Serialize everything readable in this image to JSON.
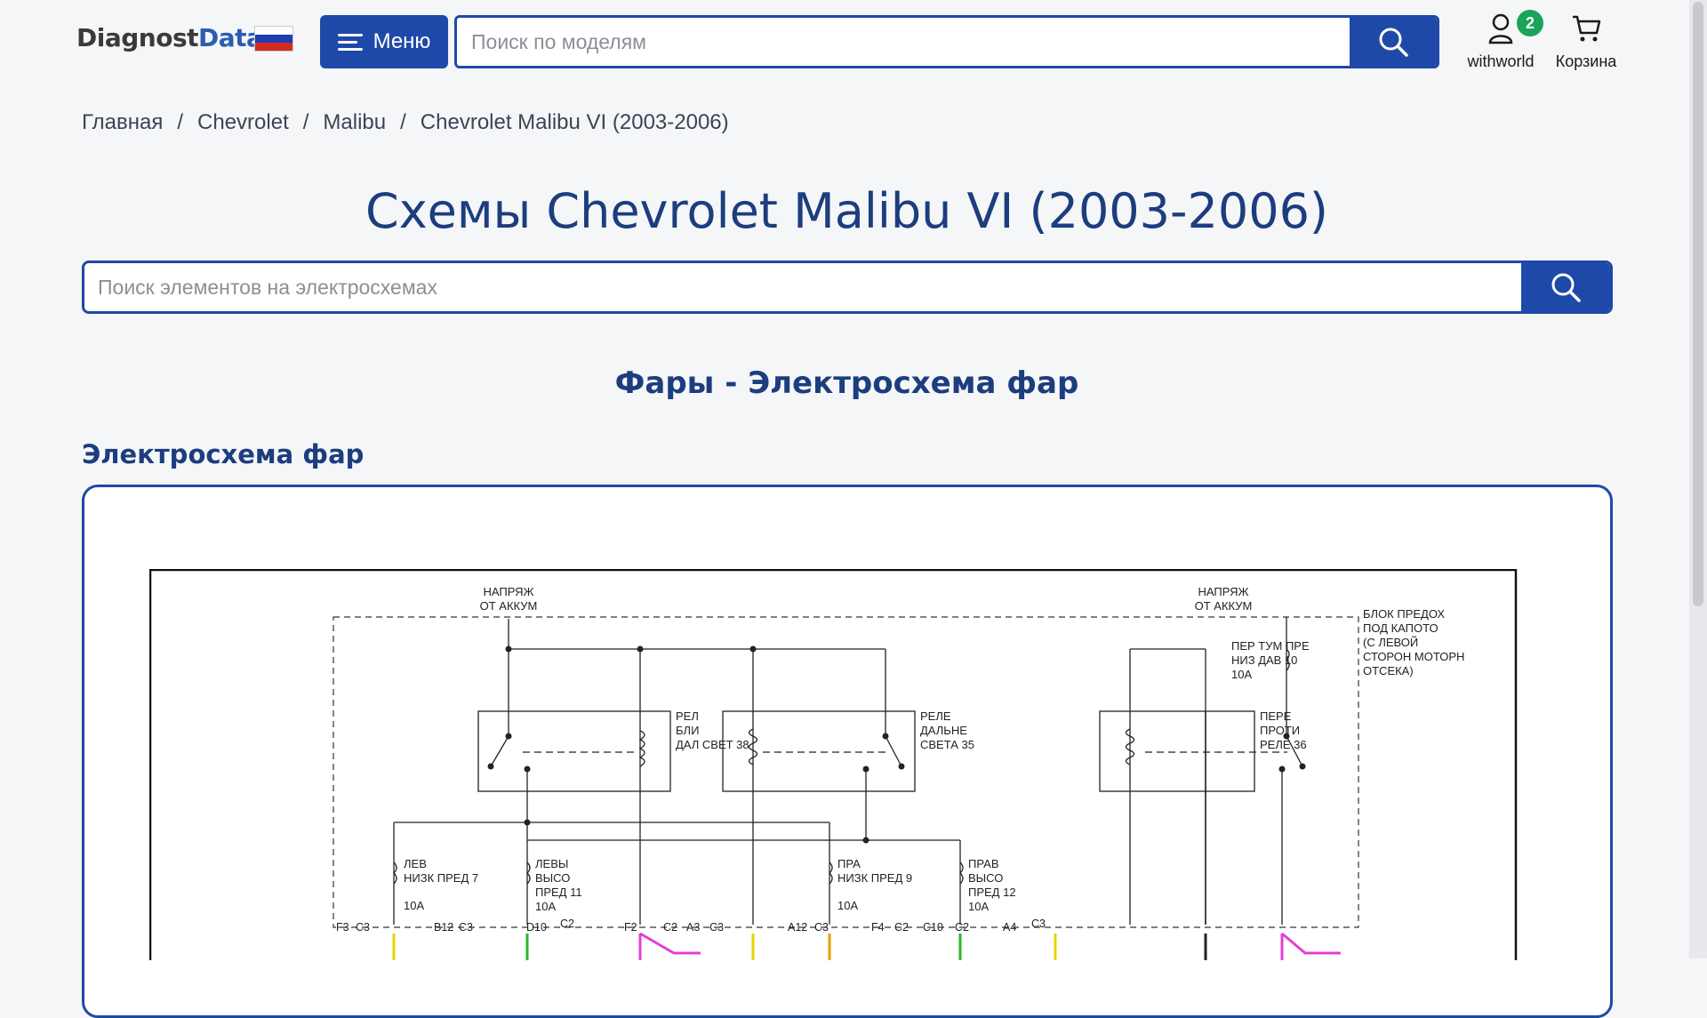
{
  "header": {
    "logo_part1": "Diagnost",
    "logo_part2": "Data",
    "menu_label": "Меню",
    "search_placeholder": "Поиск по моделям",
    "user_label": "withworld",
    "user_badge": "2",
    "cart_label": "Корзина"
  },
  "breadcrumb": {
    "items": [
      "Главная",
      "Chevrolet",
      "Malibu",
      "Chevrolet Malibu VI (2003-2006)"
    ],
    "separator": "/"
  },
  "page_title": "Схемы Chevrolet Malibu VI (2003-2006)",
  "element_search": {
    "placeholder": "Поиск элементов на электросхемах"
  },
  "section_title": "Фары - Электросхема фар",
  "sub_title": "Электросхема фар",
  "diagram": {
    "labels": {
      "bat1": [
        "НАПРЯЖ",
        "ОТ АККУМ"
      ],
      "bat2": [
        "НАПРЯЖ",
        "ОТ АККУМ"
      ],
      "block": [
        "БЛОК ПРЕДОХ",
        "ПОД КАПОТО",
        "(С ЛЕВОЙ",
        "СТОРОН МОТОРН",
        "ОТСЕКА)"
      ],
      "relay_low": [
        "РЕЛ",
        "БЛИ",
        "ДАЛ СВЕТ 38"
      ],
      "relay_high": [
        "РЕЛЕ",
        "ДАЛЬНЕ",
        "СВЕТА 35"
      ],
      "relay_fog": [
        "ПЕРЕ",
        "ПРОТИ",
        "РЕЛЕ 36"
      ],
      "fuse_fog": [
        "ПЕР ТУМ ПРЕ",
        "НИЗ ДАВ 10",
        "10A"
      ],
      "fuse7": [
        "ЛЕВ",
        "НИЗК ПРЕД 7",
        "10A"
      ],
      "fuse11": [
        "ЛЕВЫ",
        "ВЫСО",
        "ПРЕД 11",
        "10A"
      ],
      "fuse9": [
        "ПРА",
        "НИЗК ПРЕД 9",
        "10A"
      ],
      "fuse12": [
        "ПРАВ",
        "ВЫСО",
        "ПРЕД 12",
        "10A"
      ]
    },
    "connectors": [
      "F3",
      "C3",
      "B12",
      "C3",
      "D10",
      "C2",
      "F2",
      "C2",
      "A3",
      "C3",
      "A12",
      "C3",
      "F4",
      "C2",
      "C10",
      "C2",
      "A4",
      "C3"
    ]
  },
  "colors": {
    "brand": "#1f49a8",
    "title": "#1c3d7e",
    "badge": "#1aa35a"
  }
}
